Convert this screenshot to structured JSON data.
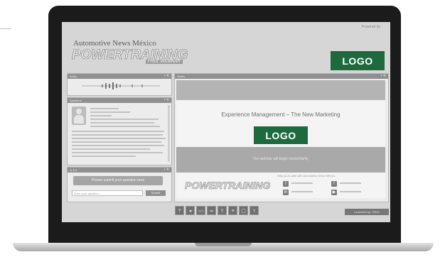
{
  "page": {
    "powered_by": "Powered by",
    "brand": {
      "publisher": "Automotive News México",
      "title": "POWERTRAINING",
      "subtitle": "FREE WEBINAR"
    },
    "logo_top": "LOGO",
    "logo_slide": "LOGO",
    "audio_panel": {
      "title": "Audio"
    },
    "speakers_panel": {
      "title": "Speakers"
    },
    "qa_panel": {
      "title": "Q & A",
      "prompt": "Please submit your question here",
      "input_placeholder": "Enter your question...",
      "submit_label": "Submit"
    },
    "slides_panel": {
      "title": "Slides",
      "slide_title": "Experience Management – The New Marketing",
      "status_text": "The webinar will begin momentarily.",
      "footer_logo": "POWERTRAINING",
      "footer_connect": "Stay up-to-date with Automotive News México"
    },
    "toolbar": {
      "buttons": [
        "help-icon",
        "volume-icon",
        "folder-icon",
        "link-icon",
        "share-icon",
        "notes-icon",
        "chat-icon",
        "twitter-icon"
      ],
      "launch_label": "Launched by: ON24"
    },
    "colors": {
      "logo_green": "#1c6a3d",
      "laptop_bezel": "#1b1b1b",
      "screen_bg": "#d6d6d6"
    }
  }
}
